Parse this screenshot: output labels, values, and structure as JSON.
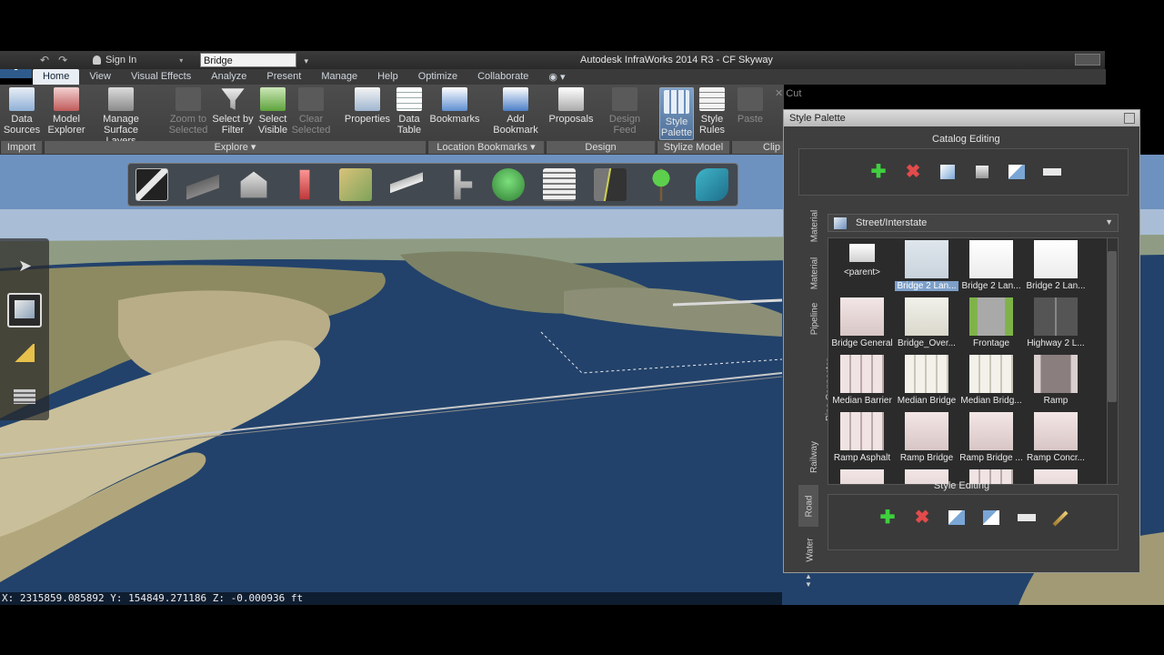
{
  "window": {
    "app_title": "Autodesk InfraWorks 2014 R3 - CF Skyway",
    "logo_letter": "I",
    "sign_in_label": "Sign In",
    "search_value": "Bridge"
  },
  "ribbon": {
    "tabs": [
      "Home",
      "View",
      "Visual Effects",
      "Analyze",
      "Present",
      "Manage",
      "Help",
      "Optimize",
      "Collaborate"
    ],
    "buttons": {
      "data_sources": "Data\nSources",
      "model_explorer": "Model\nExplorer",
      "manage_surface_layers": "Manage\nSurface Layers",
      "zoom_to_selected": "Zoom to\nSelected",
      "select_by_filter": "Select by\nFilter",
      "select_visible": "Select\nVisible",
      "clear_selected": "Clear\nSelected",
      "properties": "Properties",
      "data_table": "Data\nTable",
      "bookmarks": "Bookmarks",
      "add_bookmark": "Add\nBookmark",
      "proposals": "Proposals",
      "design_feed": "Design Feed",
      "style_palette": "Style\nPalette",
      "style_rules": "Style\nRules",
      "paste": "Paste",
      "cut": "Cut"
    },
    "panels": {
      "import": "Import",
      "explore": "Explore",
      "location_bookmarks": "Location Bookmarks",
      "design": "Design",
      "stylize_model": "Stylize Model",
      "clip": "Clip"
    }
  },
  "status": {
    "coordinates": "X: 2315859.085892 Y: 154849.271186 Z: -0.000936 ft"
  },
  "palette": {
    "title": "Style Palette",
    "catalog_editing_label": "Catalog Editing",
    "style_editing_label": "Style Editing",
    "category": "Street/Interstate",
    "vertical_tabs": [
      "Material",
      "Material",
      "Pipeline",
      "Pipe Connector",
      "Railway",
      "Road",
      "Water"
    ],
    "tiles": [
      {
        "label": "<parent>",
        "kind": "folder"
      },
      {
        "label": "Bridge 2 Lan...",
        "kind": "plain-blue",
        "selected": true
      },
      {
        "label": "Bridge 2 Lan...",
        "kind": "white"
      },
      {
        "label": "Bridge 2 Lan...",
        "kind": "white"
      },
      {
        "label": "Bridge General",
        "kind": "pink"
      },
      {
        "label": "Bridge_Over...",
        "kind": "light"
      },
      {
        "label": "Frontage",
        "kind": "grass-road"
      },
      {
        "label": "Highway 2 L...",
        "kind": "dark-road"
      },
      {
        "label": "Median Barrier",
        "kind": "pink-lanes"
      },
      {
        "label": "Median Bridge",
        "kind": "light-lanes"
      },
      {
        "label": "Median Bridg...",
        "kind": "light-lanes"
      },
      {
        "label": "Ramp",
        "kind": "ramp"
      },
      {
        "label": "Ramp Asphalt",
        "kind": "pink-lanes"
      },
      {
        "label": "Ramp Bridge",
        "kind": "pink"
      },
      {
        "label": "Ramp Bridge ...",
        "kind": "pink"
      },
      {
        "label": "Ramp Concr...",
        "kind": "pink"
      },
      {
        "label": "",
        "kind": "pink"
      },
      {
        "label": "",
        "kind": "pink"
      },
      {
        "label": "",
        "kind": "pink-lanes"
      },
      {
        "label": "",
        "kind": "pink"
      }
    ]
  },
  "colors": {
    "accent": "#7c9fc9",
    "add_green": "#3fcf3f",
    "delete_red": "#e24b4b"
  }
}
